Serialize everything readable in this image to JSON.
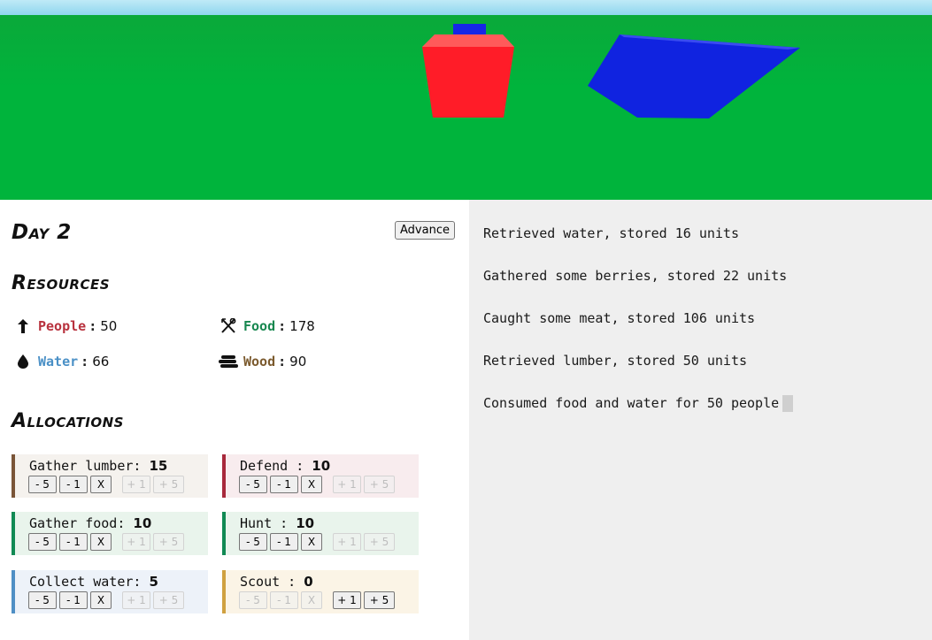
{
  "scene": {
    "sky_color": "#a8e3f5",
    "ground_color": "#00b43c",
    "objects": [
      {
        "name": "red-building",
        "color": "#ff1c28"
      },
      {
        "name": "blue-building",
        "color": "#1023e0"
      }
    ]
  },
  "day": {
    "title": "Day 2"
  },
  "advance_label": "Advance",
  "resources": {
    "title": "Resources",
    "people": {
      "label": "People",
      "value": "50",
      "color": "#b8323e",
      "icon": "person-arrow-icon"
    },
    "food": {
      "label": "Food",
      "value": "178",
      "color": "#17874f",
      "icon": "fork-knife-icon"
    },
    "water": {
      "label": "Water",
      "value": "66",
      "color": "#4a90c6",
      "icon": "water-drop-icon"
    },
    "wood": {
      "label": "Wood",
      "value": "90",
      "color": "#7b5a2e",
      "icon": "wood-logs-icon"
    }
  },
  "allocations": {
    "title": "Allocations",
    "buttons": {
      "minus5": "- 5",
      "minus1": "- 1",
      "clear": "X",
      "plus1": "+ 1",
      "plus5": "+ 5"
    },
    "items": [
      {
        "label": "Gather lumber",
        "value": "15",
        "color": "#7a5538"
      },
      {
        "label": "Defend",
        "value": "10",
        "color": "#a8293c"
      },
      {
        "label": "Gather food",
        "value": "10",
        "color": "#118a54"
      },
      {
        "label": "Hunt",
        "value": "10",
        "color": "#118a54"
      },
      {
        "label": "Collect water",
        "value": "5",
        "color": "#4f8fc5"
      },
      {
        "label": "Scout",
        "value": "0",
        "color": "#d0a140"
      }
    ]
  },
  "log": [
    "Retrieved water, stored 16 units",
    "Gathered some berries, stored 22 units",
    "Caught some meat, stored 106 units",
    "Retrieved lumber, stored 50 units",
    "Consumed food and water for 50 people"
  ]
}
